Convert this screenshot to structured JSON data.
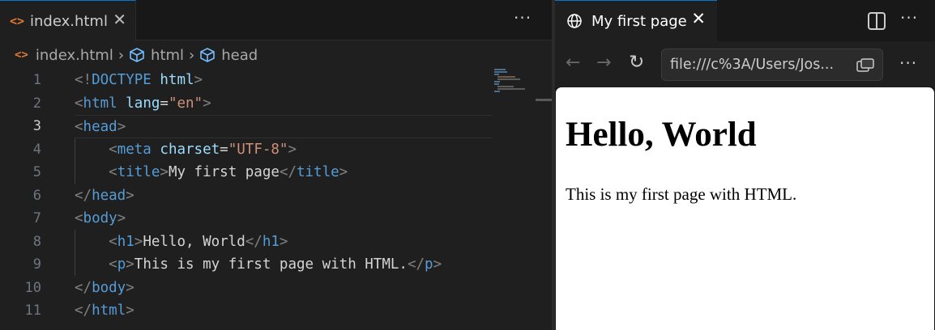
{
  "editor": {
    "tab": {
      "icon": "html-file-icon",
      "label": "index.html",
      "close": "✕"
    },
    "more": "···",
    "breadcrumb": {
      "items": [
        {
          "icon": "html-file-icon",
          "label": "index.html"
        },
        {
          "icon": "symbol-element-icon",
          "label": "html"
        },
        {
          "icon": "symbol-element-icon",
          "label": "head"
        }
      ],
      "separator": "›"
    },
    "active_line": 3,
    "line_numbers": [
      "1",
      "2",
      "3",
      "4",
      "5",
      "6",
      "7",
      "8",
      "9",
      "10",
      "11"
    ],
    "code": [
      "<!DOCTYPE html>",
      "<html lang=\"en\">",
      "<head>",
      "    <meta charset=\"UTF-8\">",
      "    <title>My first page</title>",
      "</head>",
      "<body>",
      "    <h1>Hello, World</h1>",
      "    <p>This is my first page with HTML.</p>",
      "</body>",
      "</html>"
    ]
  },
  "browser": {
    "tab": {
      "icon": "globe-icon",
      "label": "My first page",
      "close": "✕"
    },
    "more": "···",
    "nav": {
      "back": "←",
      "forward": "→",
      "refresh": "↻",
      "url": "file:///c%3A/Users/Jos...",
      "more": "···"
    },
    "page": {
      "heading": "Hello, World",
      "paragraph": "This is my first page with HTML."
    }
  },
  "colors": {
    "tag": "#569cd6",
    "attribute": "#9cdcfe",
    "string": "#ce9178",
    "punctuation": "#808080",
    "text": "#d4d4d4",
    "html_icon": "#e37933",
    "focus_border": "#0078d4"
  }
}
